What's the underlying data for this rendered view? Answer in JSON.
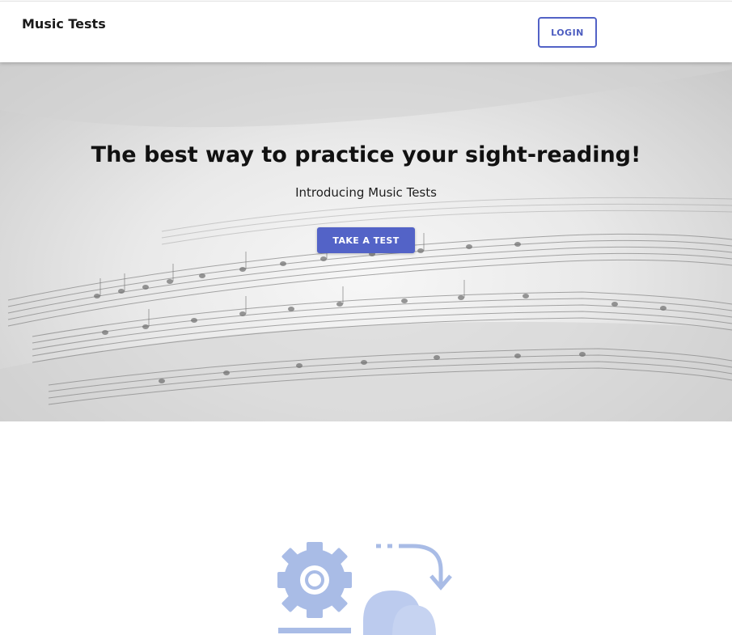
{
  "header": {
    "brand": "Music Tests",
    "login_label": "LOGIN"
  },
  "hero": {
    "title": "The best way to practice your sight-reading!",
    "subtitle": "Introducing Music Tests",
    "cta_label": "TAKE A TEST",
    "background_image": "sheet-music-photo"
  },
  "illustration": {
    "icons": [
      "gear-icon",
      "cycle-arrow-icon",
      "person-icon"
    ],
    "color": "#a9bce6"
  },
  "colors": {
    "accent": "#5363c7",
    "text": "#111111"
  }
}
